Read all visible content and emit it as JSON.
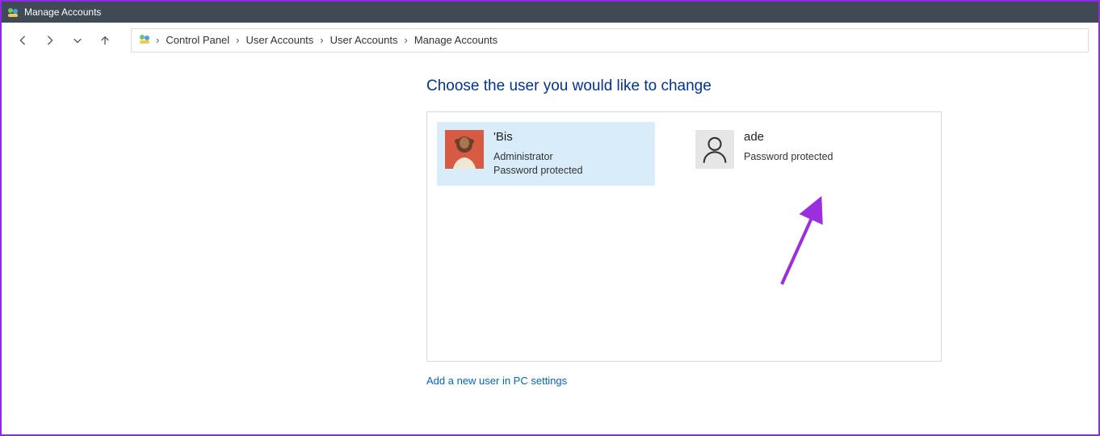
{
  "window": {
    "title": "Manage Accounts"
  },
  "breadcrumb": {
    "items": [
      "Control Panel",
      "User Accounts",
      "User Accounts",
      "Manage Accounts"
    ]
  },
  "heading": "Choose the user you would like to change",
  "accounts": [
    {
      "name": "'Bis",
      "role": "Administrator",
      "protection": "Password protected",
      "selected": true,
      "avatar": "photo"
    },
    {
      "name": "ade",
      "role": "",
      "protection": "Password protected",
      "selected": false,
      "avatar": "generic"
    }
  ],
  "add_user_link": "Add a new user in PC settings",
  "annotation": {
    "color": "#9b2fe0"
  }
}
